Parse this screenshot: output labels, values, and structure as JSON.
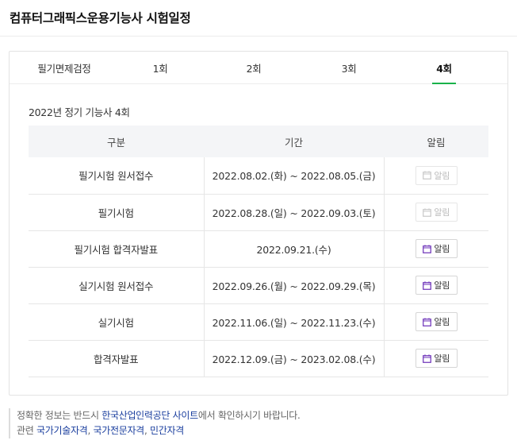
{
  "page": {
    "title": "컴퓨터그래픽스운용기능사 시험일정"
  },
  "tabs": [
    {
      "label": "필기면제검정",
      "active": false
    },
    {
      "label": "1회",
      "active": false
    },
    {
      "label": "2회",
      "active": false
    },
    {
      "label": "3회",
      "active": false
    },
    {
      "label": "4회",
      "active": true
    }
  ],
  "subtitle": "2022년 정기 기능사 4회",
  "table": {
    "headers": [
      "구분",
      "기간",
      "알림"
    ],
    "rows": [
      {
        "category": "필기시험 원서접수",
        "period": "2022.08.02.(화) ~ 2022.08.05.(금)",
        "alarm_label": "알림",
        "alarm_enabled": false
      },
      {
        "category": "필기시험",
        "period": "2022.08.28.(일) ~ 2022.09.03.(토)",
        "alarm_label": "알림",
        "alarm_enabled": false
      },
      {
        "category": "필기시험 합격자발표",
        "period": "2022.09.21.(수)",
        "alarm_label": "알림",
        "alarm_enabled": true
      },
      {
        "category": "실기시험 원서접수",
        "period": "2022.09.26.(월) ~ 2022.09.29.(목)",
        "alarm_label": "알림",
        "alarm_enabled": true
      },
      {
        "category": "실기시험",
        "period": "2022.11.06.(일) ~ 2022.11.23.(수)",
        "alarm_label": "알림",
        "alarm_enabled": true
      },
      {
        "category": "합격자발표",
        "period": "2022.12.09.(금) ~ 2023.02.08.(수)",
        "alarm_label": "알림",
        "alarm_enabled": true
      }
    ]
  },
  "note": {
    "line1_prefix": "정확한 정보는 반드시 ",
    "line1_link": "한국산업인력공단 사이트",
    "line1_suffix": "에서 확인하시기 바랍니다.",
    "line2_prefix": "관련 ",
    "line2_links": [
      "국가기술자격",
      "국가전문자격",
      "민간자격"
    ],
    "line2_sep": ", "
  },
  "colors": {
    "tab_active_underline": "#19b24a",
    "link": "#1a3e9e",
    "calendar_icon_active": "#6b2fb8",
    "calendar_icon_disabled": "#c8c8c8"
  }
}
